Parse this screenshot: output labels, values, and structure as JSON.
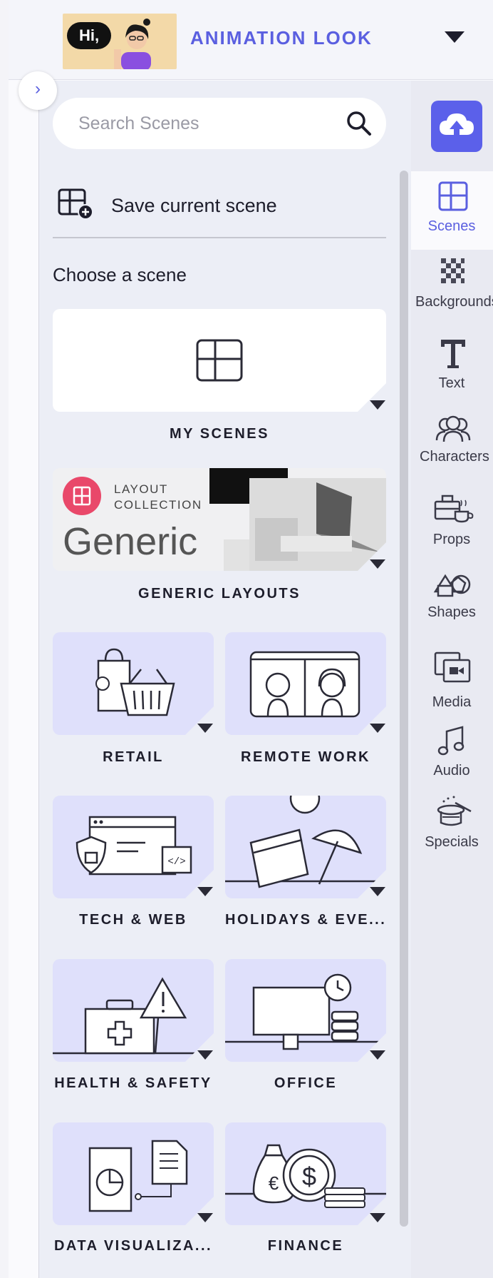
{
  "header": {
    "thumbnail_text": "Hi,",
    "title": "ANIMATION LOOK"
  },
  "search": {
    "placeholder": "Search Scenes",
    "value": ""
  },
  "save_scene": {
    "label": "Save current scene"
  },
  "choose_heading": "Choose a scene",
  "generic_card": {
    "line1": "LAYOUT",
    "line2": "COLLECTION",
    "word": "Generic"
  },
  "categories": [
    {
      "label": "MY SCENES"
    },
    {
      "label": "GENERIC LAYOUTS"
    },
    {
      "label": "RETAIL"
    },
    {
      "label": "REMOTE WORK"
    },
    {
      "label": "TECH & WEB"
    },
    {
      "label": "HOLIDAYS & EVE..."
    },
    {
      "label": "HEALTH & SAFETY"
    },
    {
      "label": "OFFICE"
    },
    {
      "label": "DATA VISUALIZA..."
    },
    {
      "label": "FINANCE"
    }
  ],
  "sidebar": {
    "items": [
      {
        "label": "Scenes",
        "icon": "scenes-icon",
        "active": true
      },
      {
        "label": "Backgrounds",
        "icon": "checkerboard-icon"
      },
      {
        "label": "Text",
        "icon": "text-icon"
      },
      {
        "label": "Characters",
        "icon": "characters-icon"
      },
      {
        "label": "Props",
        "icon": "props-icon"
      },
      {
        "label": "Shapes",
        "icon": "shapes-icon"
      },
      {
        "label": "Media",
        "icon": "media-icon"
      },
      {
        "label": "Audio",
        "icon": "music-note-icon"
      },
      {
        "label": "Specials",
        "icon": "magic-hat-icon"
      }
    ]
  },
  "colors": {
    "accent": "#5a5fe0",
    "upload_button": "#5b60ea",
    "card_lavender": "#dfe0fb",
    "panel_bg": "#eceef6"
  }
}
